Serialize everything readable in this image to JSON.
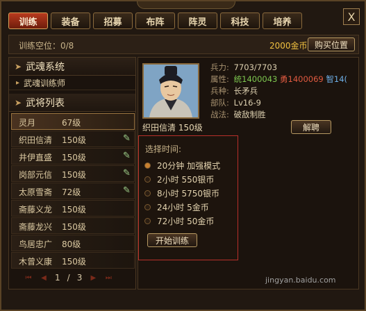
{
  "tabs": [
    "训练",
    "装备",
    "招募",
    "布阵",
    "阵灵",
    "科技",
    "培养"
  ],
  "close_label": "X",
  "training_slots": "训练空位：0/8",
  "gold": "2000金币",
  "buy_slot_label": "购买位置",
  "sections": {
    "wuhun": {
      "title": "武魂系统",
      "sub": "武魂训练师"
    },
    "generals": {
      "title": "武将列表"
    }
  },
  "general_list": [
    {
      "name": "灵月",
      "level": "67级",
      "selected": true
    },
    {
      "name": "织田信清",
      "level": "150级"
    },
    {
      "name": "井伊直盛",
      "level": "150级"
    },
    {
      "name": "岗部元信",
      "level": "150级"
    },
    {
      "name": "太原雪斋",
      "level": "72级"
    },
    {
      "name": "斋藤义龙",
      "level": "150级"
    },
    {
      "name": "斋藤龙兴",
      "level": "150级"
    },
    {
      "name": "鸟居忠广",
      "level": "80级"
    },
    {
      "name": "木曾义康",
      "level": "150级"
    }
  ],
  "pager": {
    "current": "1",
    "total": "3"
  },
  "detail": {
    "name_level": "织田信清   150级",
    "troops_label": "兵力:",
    "troops": "7703/7703",
    "attr_label": "属性:",
    "attr_tong": "统1400043",
    "attr_yong": "勇1400069",
    "attr_zhi": "智14(",
    "type_label": "兵种:",
    "type": "长矛兵",
    "dept_label": "部队:",
    "dept": "Lv16-9",
    "tactic_label": "战法:",
    "tactic": "破敌制胜",
    "dismiss_label": "解聘"
  },
  "training": {
    "title": "选择时间:",
    "options": [
      "20分钟   加强模式",
      "2小时    550银币",
      "8小时    5750银币",
      "24小时    5金币",
      "72小时    50金币"
    ],
    "start_label": "开始训练"
  },
  "watermark": "jingyan.baidu.com"
}
